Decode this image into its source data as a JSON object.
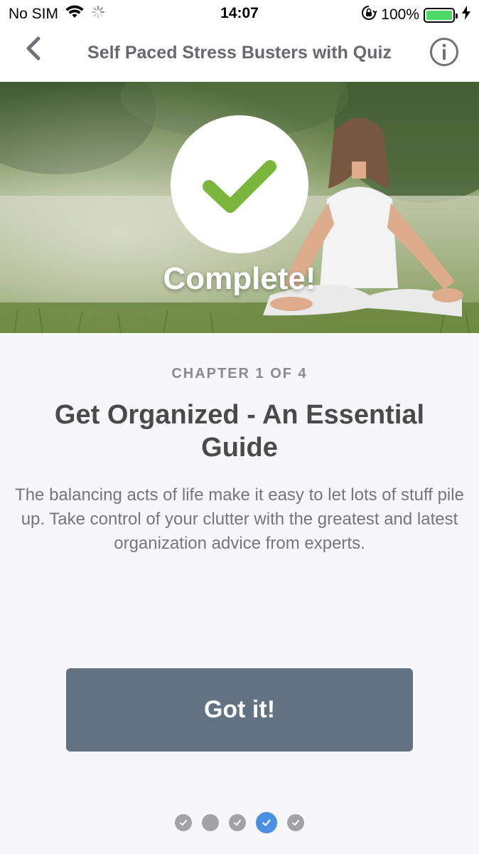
{
  "status_bar": {
    "carrier": "No SIM",
    "time": "14:07",
    "battery": "100%"
  },
  "nav": {
    "title": "Self Paced Stress Busters with Quiz"
  },
  "hero": {
    "label": "Complete!"
  },
  "content": {
    "chapter": "CHAPTER 1 OF 4",
    "heading": "Get Organized - An Essential Guide",
    "description": "The balancing acts of life make it easy to let lots of stuff pile up. Take control of your clutter with the greatest and latest organization advice from experts."
  },
  "cta": {
    "label": "Got it!"
  },
  "pagination": {
    "total": 5,
    "current": 4,
    "states": [
      "checked",
      "incomplete",
      "checked",
      "current-checked",
      "checked"
    ]
  },
  "colors": {
    "check_green": "#7bb63c",
    "button_bg": "#627282",
    "active_dot": "#4a90e2"
  }
}
